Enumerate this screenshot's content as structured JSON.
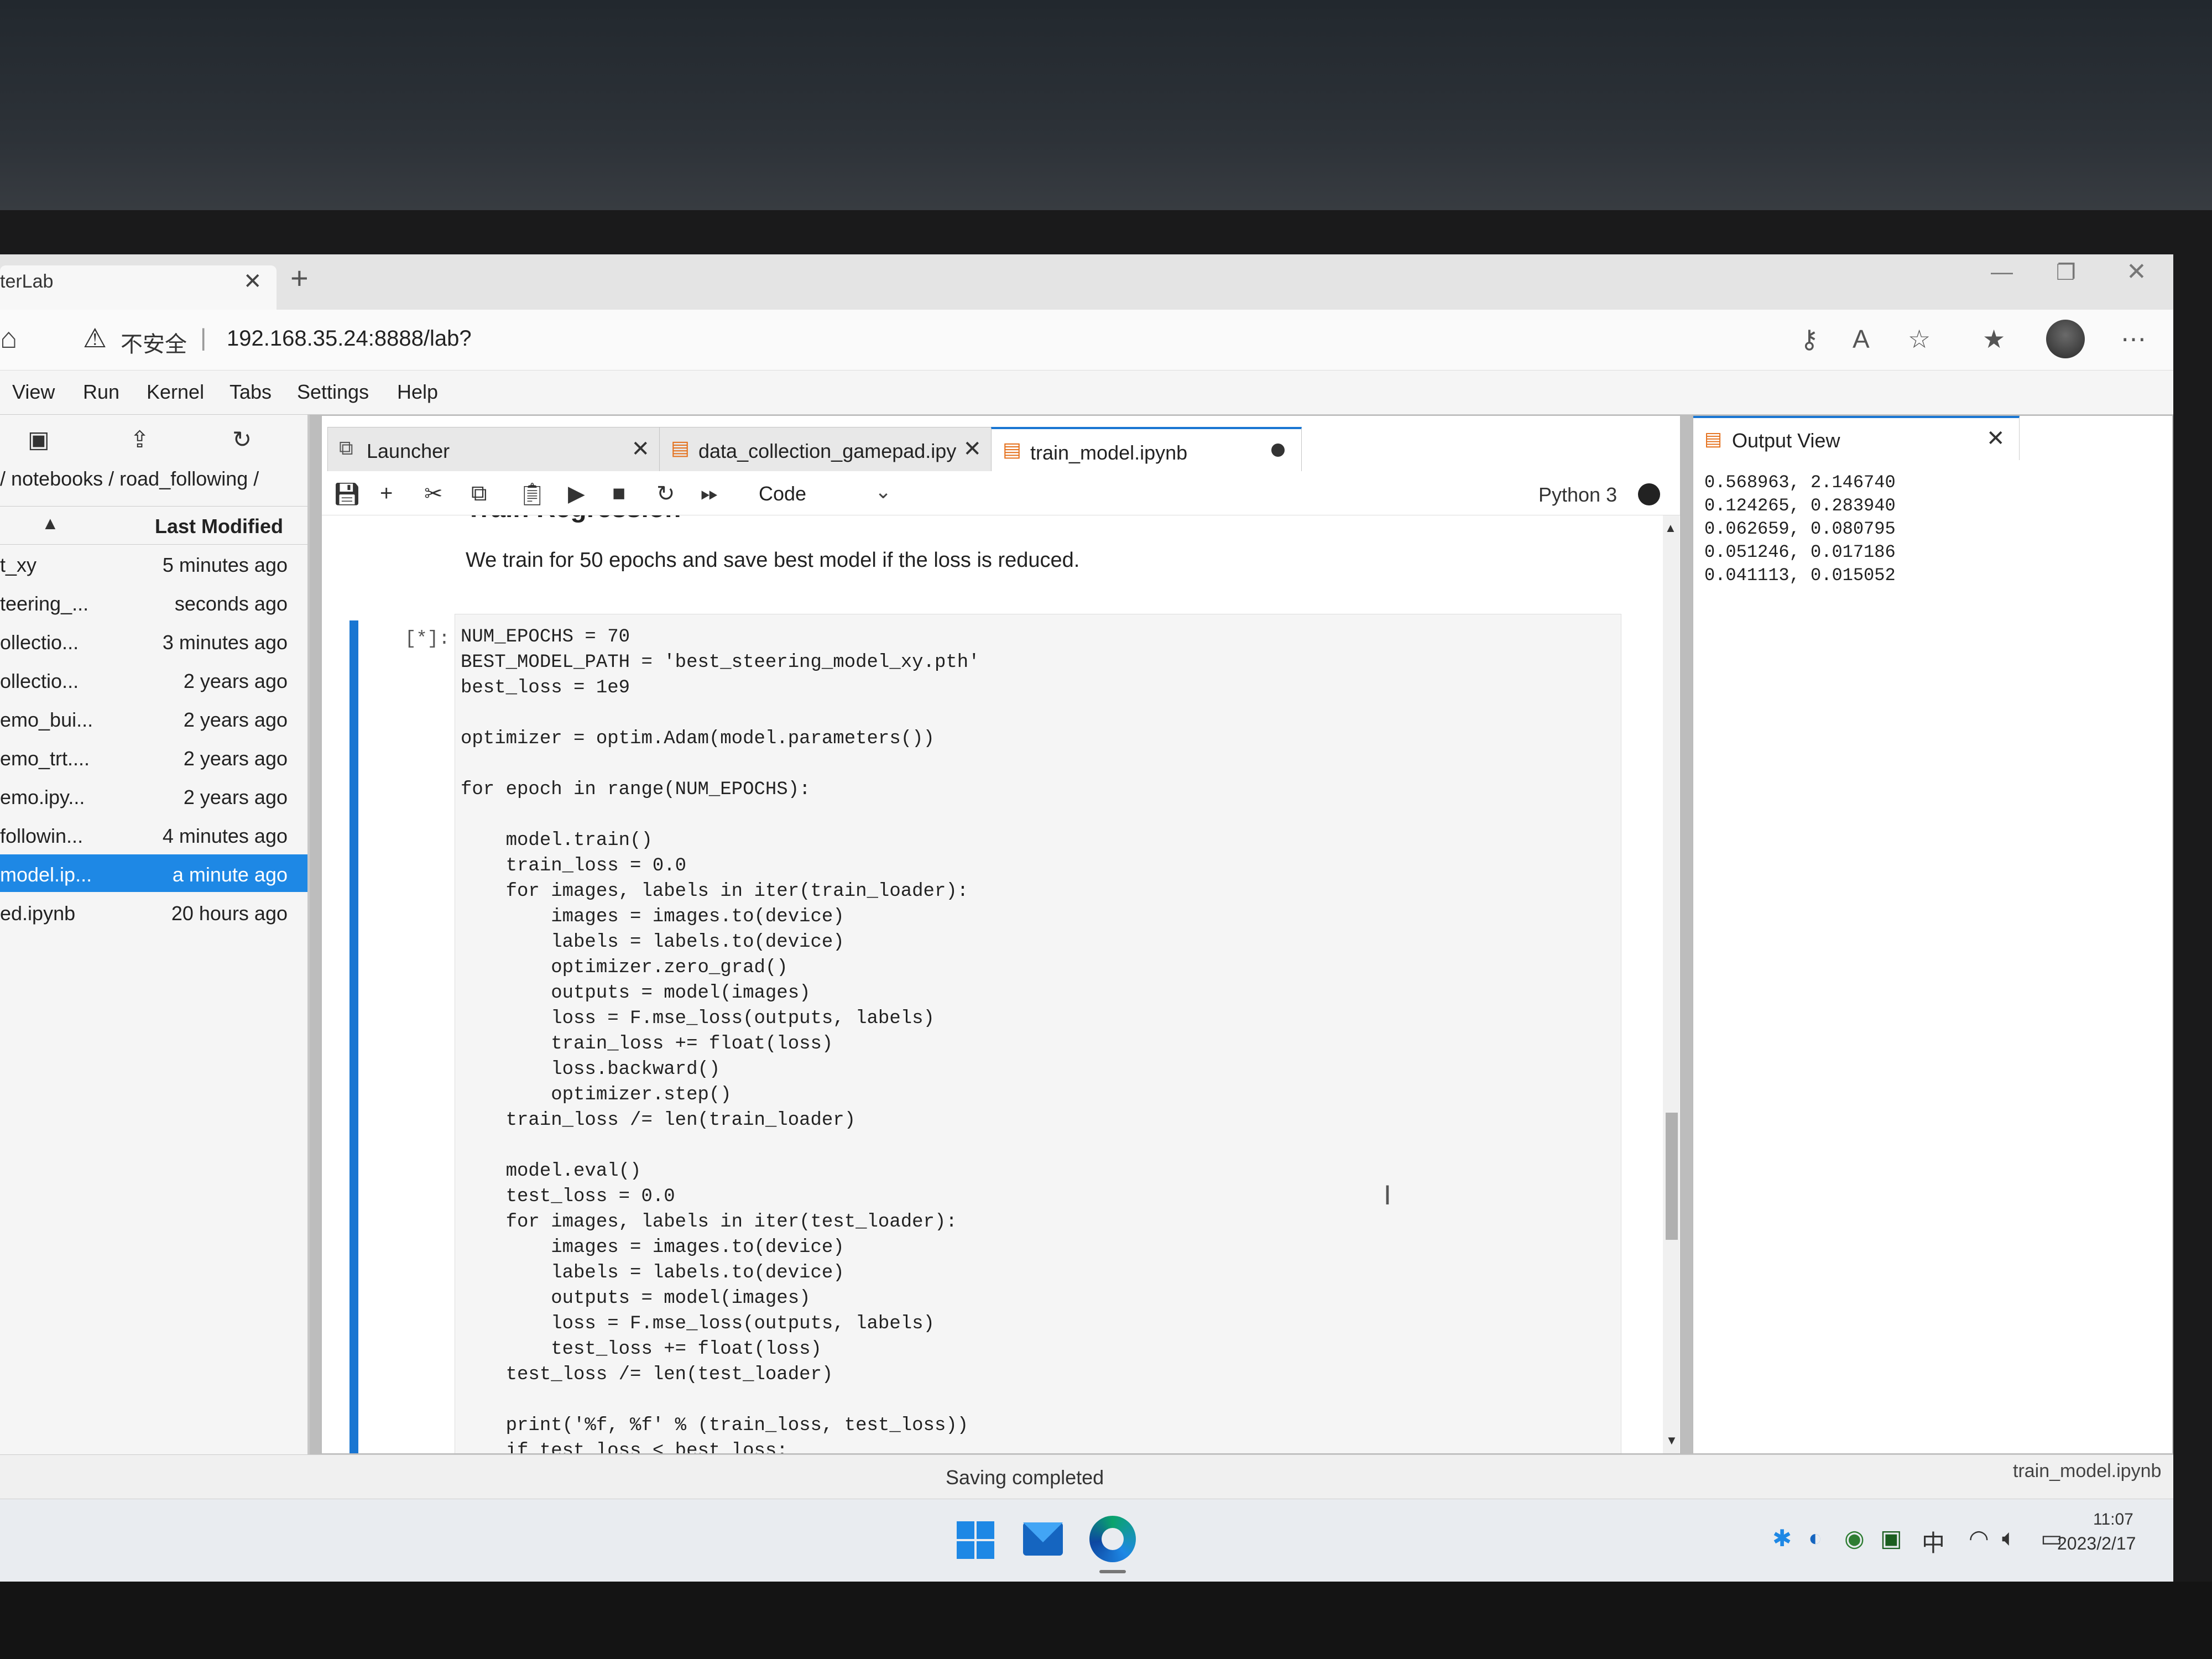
{
  "browser": {
    "tab_title": "terLab",
    "tab_close": "✕",
    "new_tab": "+",
    "security_label": "不安全",
    "url_separator": "|",
    "url": "192.168.35.24:8888/lab?"
  },
  "menu": {
    "items": [
      "View",
      "Run",
      "Kernel",
      "Tabs",
      "Settings",
      "Help"
    ]
  },
  "file_browser": {
    "path": "/ notebooks / road_following /",
    "column_header": "Last Modified",
    "files": [
      {
        "name": "t_xy",
        "modified": "5 minutes ago"
      },
      {
        "name": "teering_...",
        "modified": "seconds ago"
      },
      {
        "name": "ollectio...",
        "modified": "3 minutes ago"
      },
      {
        "name": "ollectio...",
        "modified": "2 years ago"
      },
      {
        "name": "emo_bui...",
        "modified": "2 years ago"
      },
      {
        "name": "emo_trt....",
        "modified": "2 years ago"
      },
      {
        "name": "emo.ipy...",
        "modified": "2 years ago"
      },
      {
        "name": "followin...",
        "modified": "4 minutes ago"
      },
      {
        "name": "model.ip...",
        "modified": "a minute ago",
        "selected": true
      },
      {
        "name": "ed.ipynb",
        "modified": "20 hours ago"
      }
    ]
  },
  "notebook_tabs": [
    {
      "label": "Launcher",
      "close": "✕"
    },
    {
      "label": "data_collection_gamepad.ipy",
      "close": "✕"
    },
    {
      "label": "train_model.ipynb",
      "active": true
    }
  ],
  "toolbar": {
    "cell_type": "Code",
    "kernel": "Python 3"
  },
  "notebook": {
    "heading_fragment": "Train Regression",
    "markdown": "We train for 50 epochs and save best model if the loss is reduced.",
    "cell_prompt": "[*]:",
    "code": [
      "NUM_EPOCHS = 70",
      "BEST_MODEL_PATH = 'best_steering_model_xy.pth'",
      "best_loss = 1e9",
      "",
      "optimizer = optim.Adam(model.parameters())",
      "",
      "for epoch in range(NUM_EPOCHS):",
      "",
      "    model.train()",
      "    train_loss = 0.0",
      "    for images, labels in iter(train_loader):",
      "        images = images.to(device)",
      "        labels = labels.to(device)",
      "        optimizer.zero_grad()",
      "        outputs = model(images)",
      "        loss = F.mse_loss(outputs, labels)",
      "        train_loss += float(loss)",
      "        loss.backward()",
      "        optimizer.step()",
      "    train_loss /= len(train_loader)",
      "",
      "    model.eval()",
      "    test_loss = 0.0",
      "    for images, labels in iter(test_loader):",
      "        images = images.to(device)",
      "        labels = labels.to(device)",
      "        outputs = model(images)",
      "        loss = F.mse_loss(outputs, labels)",
      "        test_loss += float(loss)",
      "    test_loss /= len(test_loader)",
      "",
      "    print('%f, %f' % (train_loss, test_loss))",
      "    if test_loss < best_loss:"
    ]
  },
  "output_view": {
    "title": "Output View",
    "close": "✕",
    "lines": [
      "0.568963, 2.146740",
      "0.124265, 0.283940",
      "0.062659, 0.080795",
      "0.051246, 0.017186",
      "0.041113, 0.015052"
    ]
  },
  "status_bar": {
    "message": "Saving completed",
    "file": "train_model.ipynb"
  },
  "taskbar": {
    "tray_ime": "中",
    "time": "11:07",
    "date": "2023/2/17"
  },
  "colors": {
    "accent": "#1976d2",
    "selection": "#1e88e5",
    "notebook_icon": "#e46f1a"
  }
}
